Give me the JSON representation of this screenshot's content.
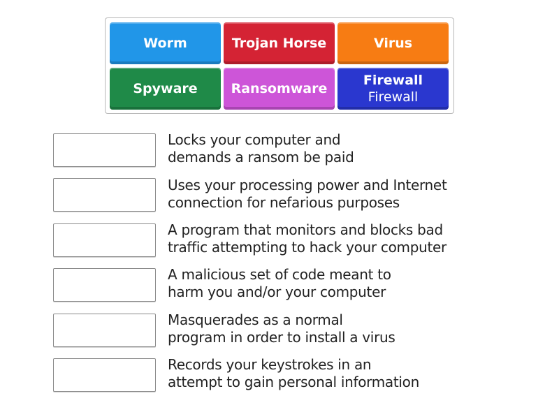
{
  "tiles": [
    {
      "label": "Worm",
      "color": "#2196e8"
    },
    {
      "label": "Trojan Horse",
      "color": "#d42334"
    },
    {
      "label": "Virus",
      "color": "#f77c13"
    },
    {
      "label": "Spyware",
      "color": "#1f8a48"
    },
    {
      "label": "Ransomware",
      "color": "#cd55d8"
    },
    {
      "label": "Firewall",
      "sublabel": "Firewall",
      "color": "#2a37cf"
    }
  ],
  "slots": [
    {
      "value": "",
      "clue": [
        "Locks your computer and",
        "demands a ransom be paid"
      ]
    },
    {
      "value": "",
      "clue": [
        "Uses your processing power and Internet",
        "connection for nefarious purposes"
      ]
    },
    {
      "value": "",
      "clue": [
        "A program that monitors and blocks bad",
        "traffic attempting to hack your computer"
      ]
    },
    {
      "value": "",
      "clue": [
        "A malicious set of code meant to",
        "harm you and/or your computer"
      ]
    },
    {
      "value": "",
      "clue": [
        "Masquerades as a normal",
        "program in order to install a virus"
      ]
    },
    {
      "value": "",
      "clue": [
        "Records your keystrokes in an",
        "attempt to gain personal information"
      ]
    }
  ]
}
